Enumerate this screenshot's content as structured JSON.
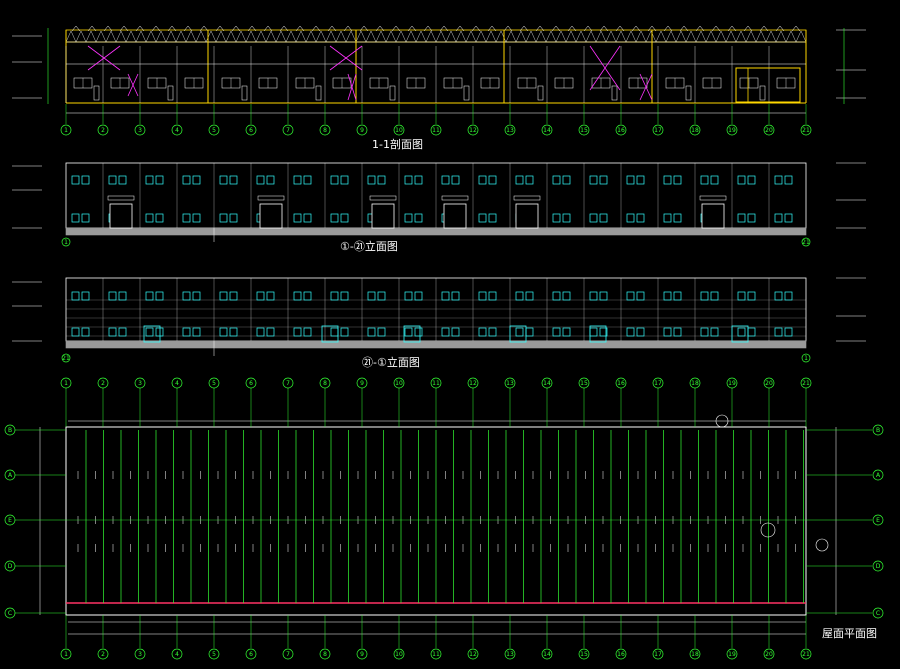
{
  "drawing": {
    "section_title": "1-1剖面图",
    "elevation_a_title": "①-㉑立面图",
    "elevation_b_title": "㉑-①立面图",
    "roof_plan_title": "屋面平面图",
    "axis_numbers": [
      "1",
      "2",
      "3",
      "4",
      "5",
      "6",
      "7",
      "8",
      "9",
      "10",
      "11",
      "12",
      "13",
      "14",
      "15",
      "16",
      "17",
      "18",
      "19",
      "20",
      "21"
    ],
    "row_letters": [
      "B",
      "A",
      "E",
      "D",
      "C"
    ],
    "colors": {
      "background": "#000000",
      "axis_green": "#33ff33",
      "beam_yellow": "#ffd700",
      "brace_magenta": "#ff33ff",
      "window_cyan": "#33ffff",
      "line_white": "#ffffff",
      "ground_gray": "#9a9a9a",
      "gutter_red": "#ff3366"
    },
    "icons": [
      "north-marker-icon",
      "axis-bubble-icon"
    ]
  }
}
